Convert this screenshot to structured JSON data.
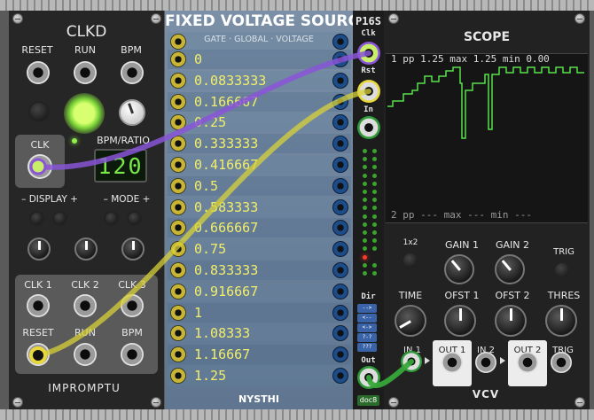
{
  "clkd": {
    "title": "CLKD",
    "reset": "RESET",
    "run": "RUN",
    "bpm": "BPM",
    "clk": "CLK",
    "bpm_ratio": "BPM/RATIO",
    "display_value": "120",
    "display_label": "– DISPLAY +",
    "mode_label": "– MODE +",
    "clk1": "CLK 1",
    "clk2": "CLK 2",
    "clk3": "CLK 3",
    "reset2": "RESET",
    "run2": "RUN",
    "bpm2": "BPM",
    "brand": "IMPROMPTU"
  },
  "fvs": {
    "title": "FIXED VOLTAGE SOURCE",
    "subtitle": "GATE · GLOBAL · VOLTAGE",
    "values": [
      "0",
      "0.0833333",
      "0.166667",
      "0.25",
      "0.333333",
      "0.416667",
      "0.5",
      "0.583333",
      "0.666667",
      "0.75",
      "0.833333",
      "0.916667",
      "1",
      "1.08333",
      "1.16667",
      "1.25"
    ],
    "brand": "NYSTHI"
  },
  "p16s": {
    "title": "P16S",
    "clk": "Clk",
    "rst": "Rst",
    "in": "In",
    "dir": "Dir",
    "out": "Out",
    "dir_buttons": [
      "-->",
      "<--",
      "<->",
      "?-?",
      "???"
    ],
    "brand": "doc8",
    "active_step": 13
  },
  "scope": {
    "title": "SCOPE",
    "line1": "1  pp  1.25  max  1.25  min  0.00",
    "line2": "2  pp  ---  max  ---  min  ---",
    "x1": "1x2",
    "gain1": "GAIN 1",
    "gain2": "GAIN 2",
    "trig": "TRIG",
    "time": "TIME",
    "ofst1": "OFST 1",
    "ofst2": "OFST 2",
    "thres": "THRES",
    "in1": "IN 1",
    "out1": "OUT 1",
    "in2": "IN 2",
    "out2": "OUT 2",
    "trig2": "TRIG",
    "brand": "VCV"
  },
  "colors": {
    "cable_purple": "#8a55d8",
    "cable_yellow": "#d8d23a",
    "cable_green": "#38a83a",
    "lcd_green": "#7ae84a"
  }
}
